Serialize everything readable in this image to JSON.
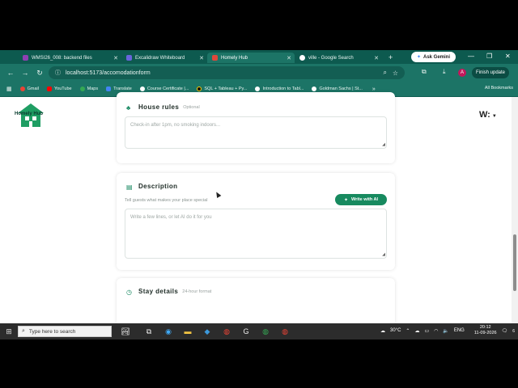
{
  "browser": {
    "tabs": [
      {
        "label": "WMSI26_008: backend files",
        "color": "#8e3fb2",
        "active": false
      },
      {
        "label": "Excalidraw Whiteboard",
        "color": "#6965db",
        "active": false
      },
      {
        "label": "Homely Hub",
        "color": "#e0473a",
        "active": true
      },
      {
        "label": "ville - Google Search",
        "color": "#ffffff",
        "active": false
      }
    ],
    "new_tab": "+",
    "ask_gemini": "Ask Gemini",
    "url": "localhost:5173/accomodationform",
    "avatar_letter": "A",
    "finish_update": "Finish update",
    "bookmarks": [
      "Gmail",
      "YouTube",
      "Maps",
      "Translate",
      "Course Certificate |...",
      "SQL + Tableau + Py...",
      "Introduction to Tabl...",
      "Goldman Sachs | St..."
    ],
    "more_bookmarks": "»",
    "all_bookmarks": "All Bookmarks"
  },
  "page": {
    "logo_text": "Homely Hub",
    "top_right": "W:",
    "house_rules": {
      "title": "House rules",
      "optional": "Optional",
      "placeholder": "Check-in after 1pm, no smoking indoors..."
    },
    "description": {
      "title": "Description",
      "help": "Tell guests what makes your place special",
      "ai_button": "Write with AI",
      "placeholder": "Write a few lines, or let AI do it for you"
    },
    "stay_details": {
      "title": "Stay details",
      "note": "24-hour format"
    }
  },
  "taskbar": {
    "search_placeholder": "Type here to search",
    "weather": "30°C",
    "language": "ENG",
    "time": "20:12",
    "date": "11-09-2026",
    "notification_count": "6"
  }
}
